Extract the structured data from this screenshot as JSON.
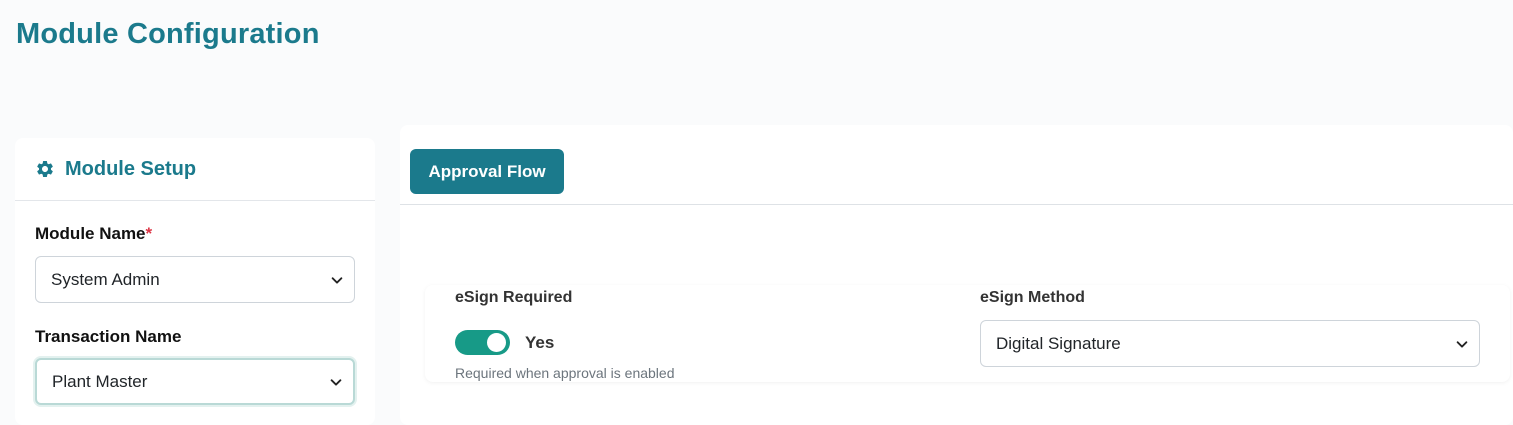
{
  "page": {
    "title": "Module Configuration"
  },
  "module_setup": {
    "header": "Module Setup",
    "icon": "gear-icon",
    "module_name_label": "Module Name",
    "required_marker": "*",
    "module_name_value": "System Admin",
    "transaction_name_label": "Transaction Name",
    "transaction_name_value": "Plant Master"
  },
  "tabs": {
    "approval_flow": "Approval Flow"
  },
  "esign": {
    "required_label": "eSign Required",
    "toggle_on": true,
    "toggle_text": "Yes",
    "help_text": "Required when approval is enabled",
    "method_label": "eSign Method",
    "method_value": "Digital Signature"
  },
  "colors": {
    "accent": "#1b7a8c",
    "toggle": "#179a87",
    "required": "#dc3545"
  }
}
